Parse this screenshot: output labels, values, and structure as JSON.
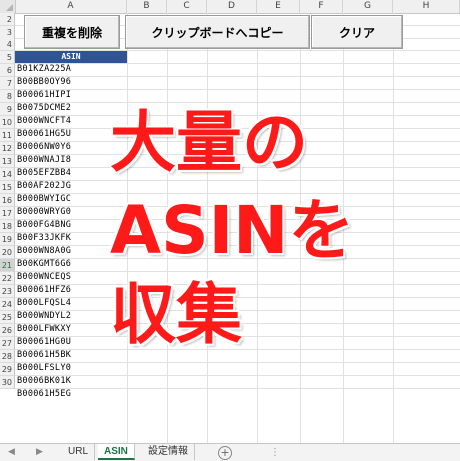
{
  "columns": [
    "A",
    "B",
    "C",
    "D",
    "E",
    "F",
    "G",
    "H"
  ],
  "rows": [
    "2",
    "3",
    "4",
    "5",
    "6",
    "7",
    "8",
    "9",
    "10",
    "11",
    "12",
    "13",
    "14",
    "15",
    "16",
    "17",
    "18",
    "19",
    "20",
    "21",
    "22",
    "23",
    "24",
    "25",
    "26",
    "27",
    "28",
    "29",
    "30"
  ],
  "selected_row": "21",
  "buttons": {
    "dedupe": "重複を削除",
    "copy": "クリップボードへコピー",
    "clear": "クリア"
  },
  "table": {
    "header": "ASIN",
    "values": [
      "B01KZA225A",
      "B00BB0OY96",
      "B00061HIPI",
      "B0075DCME2",
      "B000WNCFT4",
      "B00061HG5U",
      "B0006NW0Y6",
      "B000WNAJI8",
      "B005EFZBB4",
      "B00AF202JG",
      "B000BWYIGC",
      "B0000WRYG0",
      "B000FG4BNG",
      "B00F33JKFK",
      "B000WN8A0G",
      "B00KGMT6G6",
      "B000WNCEQS",
      "B00061HFZ6",
      "B000LFQSL4",
      "B000WNDYL2",
      "B000LFWKXY",
      "B00061HG0U",
      "B00061H5BK",
      "B000LFSLY0",
      "B0006BK01K",
      "B00061H5EG"
    ]
  },
  "overlay": {
    "line1": "大量の",
    "line2": "ASINを",
    "line3": "収集"
  },
  "tabs": {
    "prev": "◀",
    "next": "▶",
    "url": "URL",
    "asin": "ASIN",
    "settings": "設定情報",
    "add": "+",
    "more": "⋮"
  }
}
